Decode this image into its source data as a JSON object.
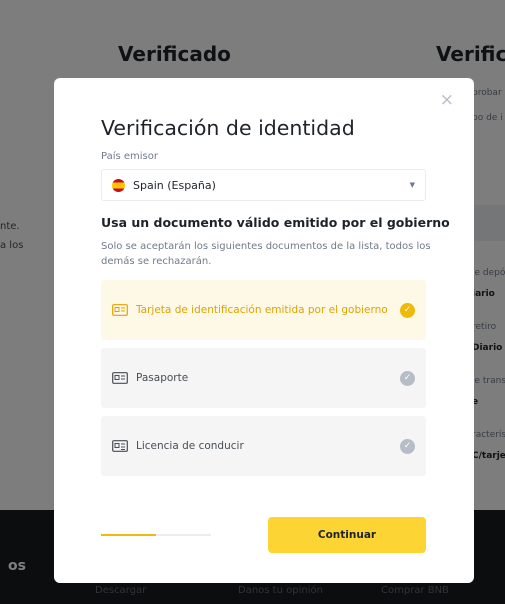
{
  "background": {
    "heading_left": "Verificado",
    "heading_right": "Verifica",
    "left_lines": [
      "nte.",
      "a los"
    ],
    "right_lines": [
      "probar",
      "po de i",
      "le depó",
      "iario",
      "retiro",
      "Diario",
      "le trans",
      "e",
      "racterís",
      "C/tarjet"
    ],
    "footer_partial": "os",
    "footer_links": [
      "Descargar",
      "Danos tu opinión",
      "Comprar BNB"
    ]
  },
  "modal": {
    "close_glyph": "×",
    "title": "Verificación de identidad",
    "country_label": "País emisor",
    "country_value": "Spain (España)",
    "section_title": "Usa un documento válido emitido por el gobierno",
    "section_desc": "Solo se aceptarán los siguientes documentos de la lista, todos los demás se rechazarán.",
    "options": [
      {
        "label": "Tarjeta de identificación emitida por el gobierno",
        "icon": "id-card-icon",
        "selected": true
      },
      {
        "label": "Pasaporte",
        "icon": "passport-icon",
        "selected": false
      },
      {
        "label": "Licencia de conducir",
        "icon": "driver-license-icon",
        "selected": false
      }
    ],
    "progress": 0.5,
    "continue_label": "Continuar"
  },
  "colors": {
    "accent": "#f0b90b",
    "button": "#fcd535",
    "selected_bg": "#fef9e6",
    "footer": "#161a1e"
  }
}
